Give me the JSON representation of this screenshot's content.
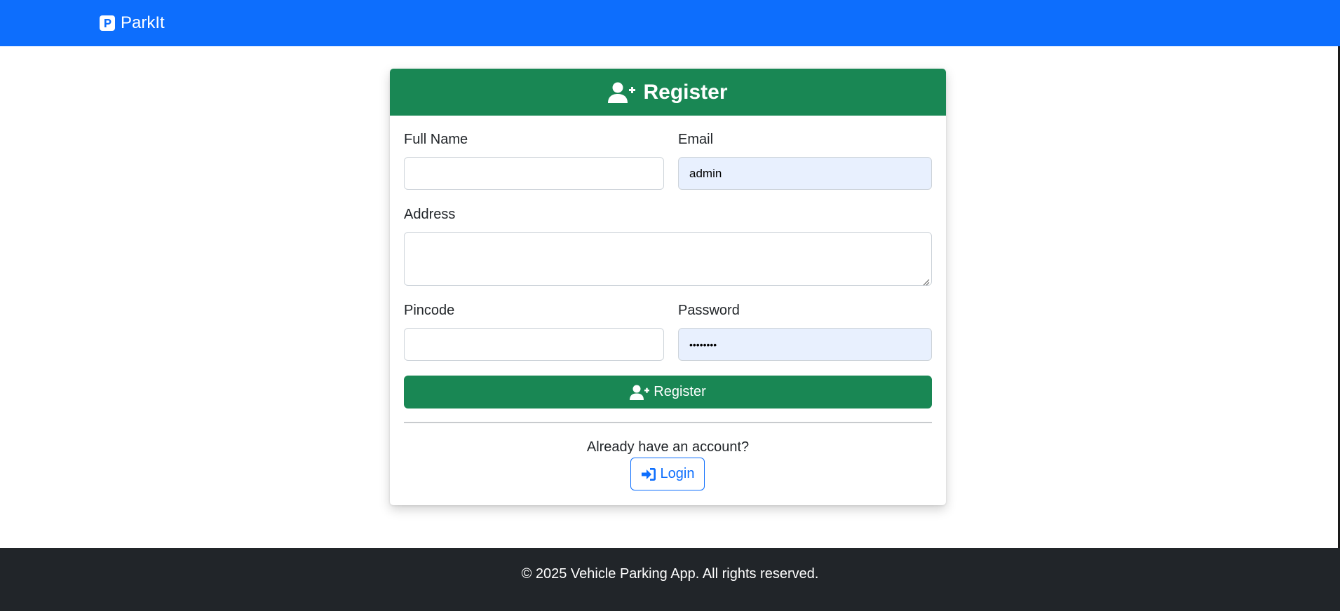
{
  "navbar": {
    "brand_icon": "parking-p-icon",
    "brand_text": "ParkIt",
    "background": "#0d6efd"
  },
  "card": {
    "header_icon": "user-plus-icon",
    "title": "Register",
    "header_color": "#198754"
  },
  "form": {
    "full_name": {
      "label": "Full Name",
      "value": ""
    },
    "email": {
      "label": "Email",
      "value": "admin"
    },
    "address": {
      "label": "Address",
      "value": ""
    },
    "pincode": {
      "label": "Pincode",
      "value": ""
    },
    "password": {
      "label": "Password",
      "value": "••••••••"
    },
    "submit_label": "Register",
    "submit_icon": "user-plus-icon"
  },
  "login_prompt": {
    "text": "Already have an account?",
    "button_label": "Login",
    "button_icon": "sign-in-icon",
    "accent": "#0d6efd"
  },
  "footer": {
    "text": "© 2025 Vehicle Parking App. All rights reserved.",
    "background": "#212529"
  }
}
